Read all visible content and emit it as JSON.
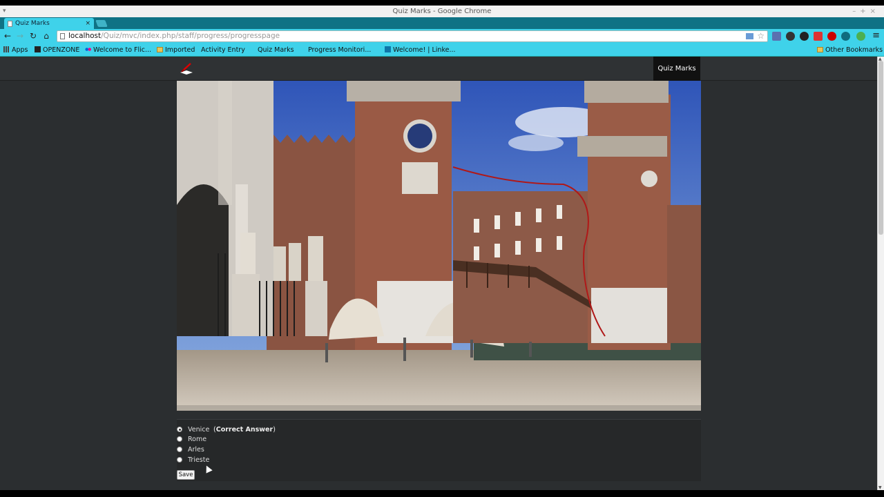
{
  "window": {
    "title": "Quiz Marks - Google Chrome"
  },
  "tab": {
    "title": "Quiz Marks",
    "close": "×"
  },
  "toolbar": {
    "url_host": "localhost",
    "url_path": "/Quiz/mvc/index.php/staff/progress/progresspage"
  },
  "bookmarks": {
    "items": [
      {
        "label": "Apps",
        "icon": "apps-icon"
      },
      {
        "label": "OPENZONE",
        "icon": "bt-icon"
      },
      {
        "label": "Welcome to Flic...",
        "icon": "flickr-icon"
      },
      {
        "label": "Imported",
        "icon": "folder-icon"
      },
      {
        "label": "Activity Entry",
        "icon": "page-icon"
      },
      {
        "label": "Quiz Marks",
        "icon": "page-icon"
      },
      {
        "label": "Progress Monitori...",
        "icon": "page-icon"
      },
      {
        "label": "Welcome! | Linke...",
        "icon": "linkedin-icon"
      }
    ],
    "other": "Other Bookmarks"
  },
  "navbar": {
    "link": "Quiz Marks"
  },
  "quiz": {
    "options": [
      {
        "label": "Venice",
        "selected": true,
        "note_open": "(",
        "note": "Correct Answer",
        "note_close": ")"
      },
      {
        "label": "Rome",
        "selected": false
      },
      {
        "label": "Arles",
        "selected": false
      },
      {
        "label": "Trieste",
        "selected": false
      }
    ],
    "save_label": "Save"
  },
  "colors": {
    "chrome_accent": "#3fd2ea",
    "tabstrip": "#0f7285",
    "page_bg": "#2b2e30"
  }
}
